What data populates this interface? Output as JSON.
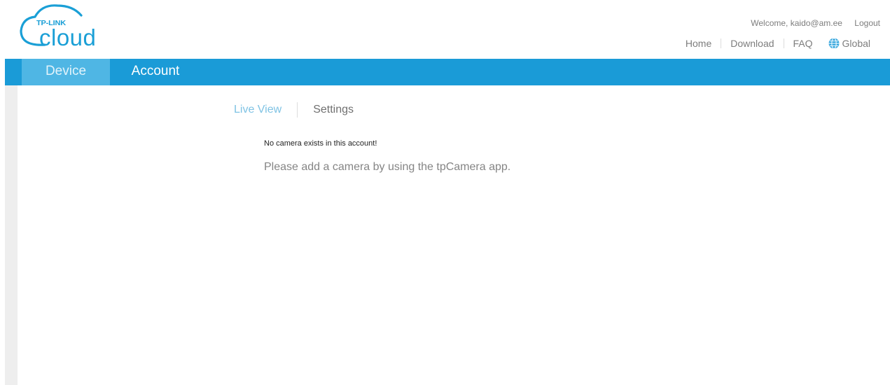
{
  "brand": {
    "top_text": "TP-LINK",
    "word": "cloud",
    "color": "#1a9fd6"
  },
  "header": {
    "welcome": "Welcome, kaido@am.ee",
    "logout": "Logout",
    "nav": {
      "home": "Home",
      "download": "Download",
      "faq": "FAQ",
      "global": "Global"
    }
  },
  "main_nav": {
    "device": "Device",
    "account": "Account",
    "bar_color": "#1a9bd7",
    "active_color": "#4fb6e4"
  },
  "sub_nav": {
    "live_view": "Live View",
    "settings": "Settings"
  },
  "message": {
    "title": "No camera exists in this account!",
    "body": "Please add a camera by using the tpCamera app."
  },
  "icons": {
    "logo": "cloud-logo-icon",
    "globe": "globe-icon"
  }
}
